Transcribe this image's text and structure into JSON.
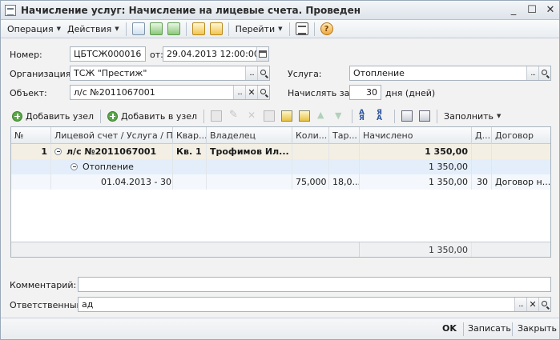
{
  "window": {
    "title": "Начисление услуг: Начисление на лицевые счета. Проведен",
    "minimize": "_",
    "maximize": "☐",
    "close": "✕"
  },
  "commandbar": {
    "operation": "Операция",
    "actions": "Действия",
    "goto": "Перейти"
  },
  "form": {
    "number_label": "Номер:",
    "number_value": "ЦБТСЖ000016",
    "date_label": "от:",
    "date_value": "29.04.2013 12:00:00",
    "org_label": "Организация:",
    "org_value": "ТСЖ \"Престиж\"",
    "service_label": "Услуга:",
    "service_value": "Отопление",
    "object_label": "Объект:",
    "object_value": "л/с №2011067001",
    "accrue_label": "Начислять за:",
    "accrue_value": "30",
    "accrue_unit": "дня (дней)",
    "comment_label": "Комментарий:",
    "comment_value": "",
    "responsible_label": "Ответственный:",
    "responsible_value": "ад"
  },
  "table_toolbar": {
    "add_node": "Добавить узел",
    "add_in_node": "Добавить в узел",
    "fill": "Заполнить"
  },
  "table": {
    "columns": [
      "№",
      "Лицевой счет / Услуга / П...",
      "Квар...",
      "Владелец",
      "Коли...",
      "Тар...",
      "Начислено",
      "Д...",
      "Договор"
    ],
    "rows": [
      {
        "num": "1",
        "account": "л/с №2011067001",
        "apt": "Кв. 1",
        "owner": "Трофимов Ил...",
        "qty": "",
        "tariff": "",
        "accrued": "1 350,00",
        "days": "",
        "contract": ""
      },
      {
        "num": "",
        "account": "Отопление",
        "apt": "",
        "owner": "",
        "qty": "",
        "tariff": "",
        "accrued": "1 350,00",
        "days": "",
        "contract": ""
      },
      {
        "num": "",
        "account": "01.04.2013 - 30...",
        "apt": "",
        "owner": "",
        "qty": "75,000",
        "tariff": "18,0...",
        "accrued": "1 350,00",
        "days": "30",
        "contract": "Договор н..."
      }
    ],
    "total_accrued": "1 350,00"
  },
  "footer": {
    "ok": "OK",
    "save": "Записать",
    "close": "Закрыть"
  }
}
